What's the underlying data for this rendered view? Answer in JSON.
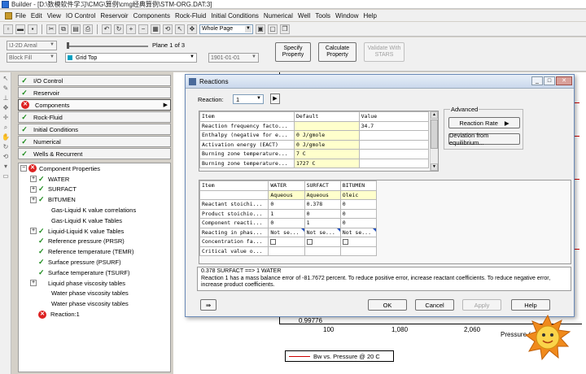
{
  "window": {
    "title": "Builder - [D:\\数模软件学习\\CMG\\算例\\cmg经典算例\\STM-ORG.DAT:3]"
  },
  "menu": [
    "File",
    "Edit",
    "View",
    "IO Control",
    "Reservoir",
    "Components",
    "Rock-Fluid",
    "Initial Conditions",
    "Numerical",
    "Well",
    "Tools",
    "Window",
    "Help"
  ],
  "toolbar": {
    "page_combo": "Whole Page"
  },
  "toolbar2": {
    "view_combo": "IJ-2D Areal",
    "fill_combo": "Block Fill",
    "property_combo": "Grid Top",
    "plane_label": "Plane 1 of 3",
    "date_combo": "1901-01-01",
    "specify_property": "Specify\nProperty",
    "calculate_property": "Calculate\nProperty",
    "validate_stars": "Validate With\nSTARS"
  },
  "nav": {
    "buttons": [
      {
        "label": "I/O Control",
        "status": "ok"
      },
      {
        "label": "Reservoir",
        "status": "ok"
      },
      {
        "label": "Components",
        "status": "error"
      },
      {
        "label": "Rock-Fluid",
        "status": "ok"
      },
      {
        "label": "Initial Conditions",
        "status": "ok"
      },
      {
        "label": "Numerical",
        "status": "ok"
      },
      {
        "label": "Wells & Recurrent",
        "status": "ok"
      }
    ]
  },
  "tree": {
    "root": "Component Properties",
    "items": [
      {
        "label": "WATER",
        "expander": true,
        "check": true,
        "indent": 1
      },
      {
        "label": "SURFACT",
        "expander": true,
        "check": true,
        "indent": 1
      },
      {
        "label": "BITUMEN",
        "expander": true,
        "check": true,
        "indent": 1
      },
      {
        "label": "Gas-Liquid K value correlations",
        "expander": false,
        "check": false,
        "indent": 2
      },
      {
        "label": "Gas-Liquid K value Tables",
        "expander": false,
        "check": false,
        "indent": 2
      },
      {
        "label": "Liquid-Liquid K value Tables",
        "expander": true,
        "check": true,
        "indent": 1
      },
      {
        "label": "Reference pressure (PRSR)",
        "expander": false,
        "check": true,
        "indent": 2
      },
      {
        "label": "Reference temperature (TEMR)",
        "expander": false,
        "check": true,
        "indent": 2
      },
      {
        "label": "Surface pressure (PSURF)",
        "expander": false,
        "check": true,
        "indent": 2
      },
      {
        "label": "Surface temperature (TSURF)",
        "expander": false,
        "check": true,
        "indent": 2
      },
      {
        "label": "Liquid phase viscosity tables",
        "expander": true,
        "check": false,
        "indent": 1
      },
      {
        "label": "Water phase viscosity tables",
        "expander": false,
        "check": false,
        "indent": 2
      },
      {
        "label": "Water phase viscosity tables",
        "expander": false,
        "check": false,
        "indent": 2
      },
      {
        "label": "Reaction:1",
        "expander": false,
        "check": false,
        "indent": 2,
        "error": true
      }
    ]
  },
  "plot": {
    "y_tick": "0.99776",
    "x_ticks": [
      "100",
      "1,080",
      "2,060"
    ],
    "x_label": "Pressure (",
    "legend": "Bw vs. Pressure @ 20 C"
  },
  "dialog": {
    "title": "Reactions",
    "reaction_label": "Reaction:",
    "reaction_value": "1",
    "top_table": {
      "headers": [
        "Item",
        "Default",
        "Value"
      ],
      "rows": [
        [
          "Reaction frequency facto...",
          "",
          "34.7"
        ],
        [
          "Enthalpy (negative for e...",
          "0 J/gmole",
          ""
        ],
        [
          "Activation energy (EACT)",
          "0 J/gmole",
          ""
        ],
        [
          "Burning zone temperature...",
          "7 C",
          ""
        ],
        [
          "Burning zone temperature...",
          "1727 C",
          ""
        ]
      ]
    },
    "advanced": {
      "label": "Advanced",
      "reaction_rate": "Reaction Rate",
      "deviation": "Deviation from equilibrium..."
    },
    "bottom_table": {
      "headers": [
        "Item",
        "WATER",
        "SURFACT",
        "BITUMEN"
      ],
      "phases": [
        "",
        "Aqueous",
        "Aqueous",
        "Oleic"
      ],
      "rows": [
        [
          "Reactant stoichi...",
          "0",
          "0.378",
          "0"
        ],
        [
          "Product stoichio...",
          "1",
          "0",
          "0"
        ],
        [
          "Component reacti...",
          "0",
          "1",
          "0"
        ],
        [
          "Reacting in phas...",
          "Not se...",
          "Not se...",
          "Not se..."
        ],
        [
          "Concentration fa...",
          "",
          "",
          ""
        ],
        [
          "Critical value o...",
          "",
          "",
          ""
        ]
      ]
    },
    "message_line1": "0.378 SURFACT ==> 1 WATER",
    "message_line2": "Reaction 1 has a mass balance error of -81.7672 percent. To reduce positive error, increase reactant coefficients. To reduce negative error, increase product coefficients.",
    "buttons": {
      "ok": "OK",
      "cancel": "Cancel",
      "apply": "Apply",
      "help": "Help"
    }
  },
  "colors": {
    "check": "#1a8a1a",
    "error": "#dd2222",
    "highlight_cell": "#ffffcc",
    "legend_line": "#cc0000"
  }
}
